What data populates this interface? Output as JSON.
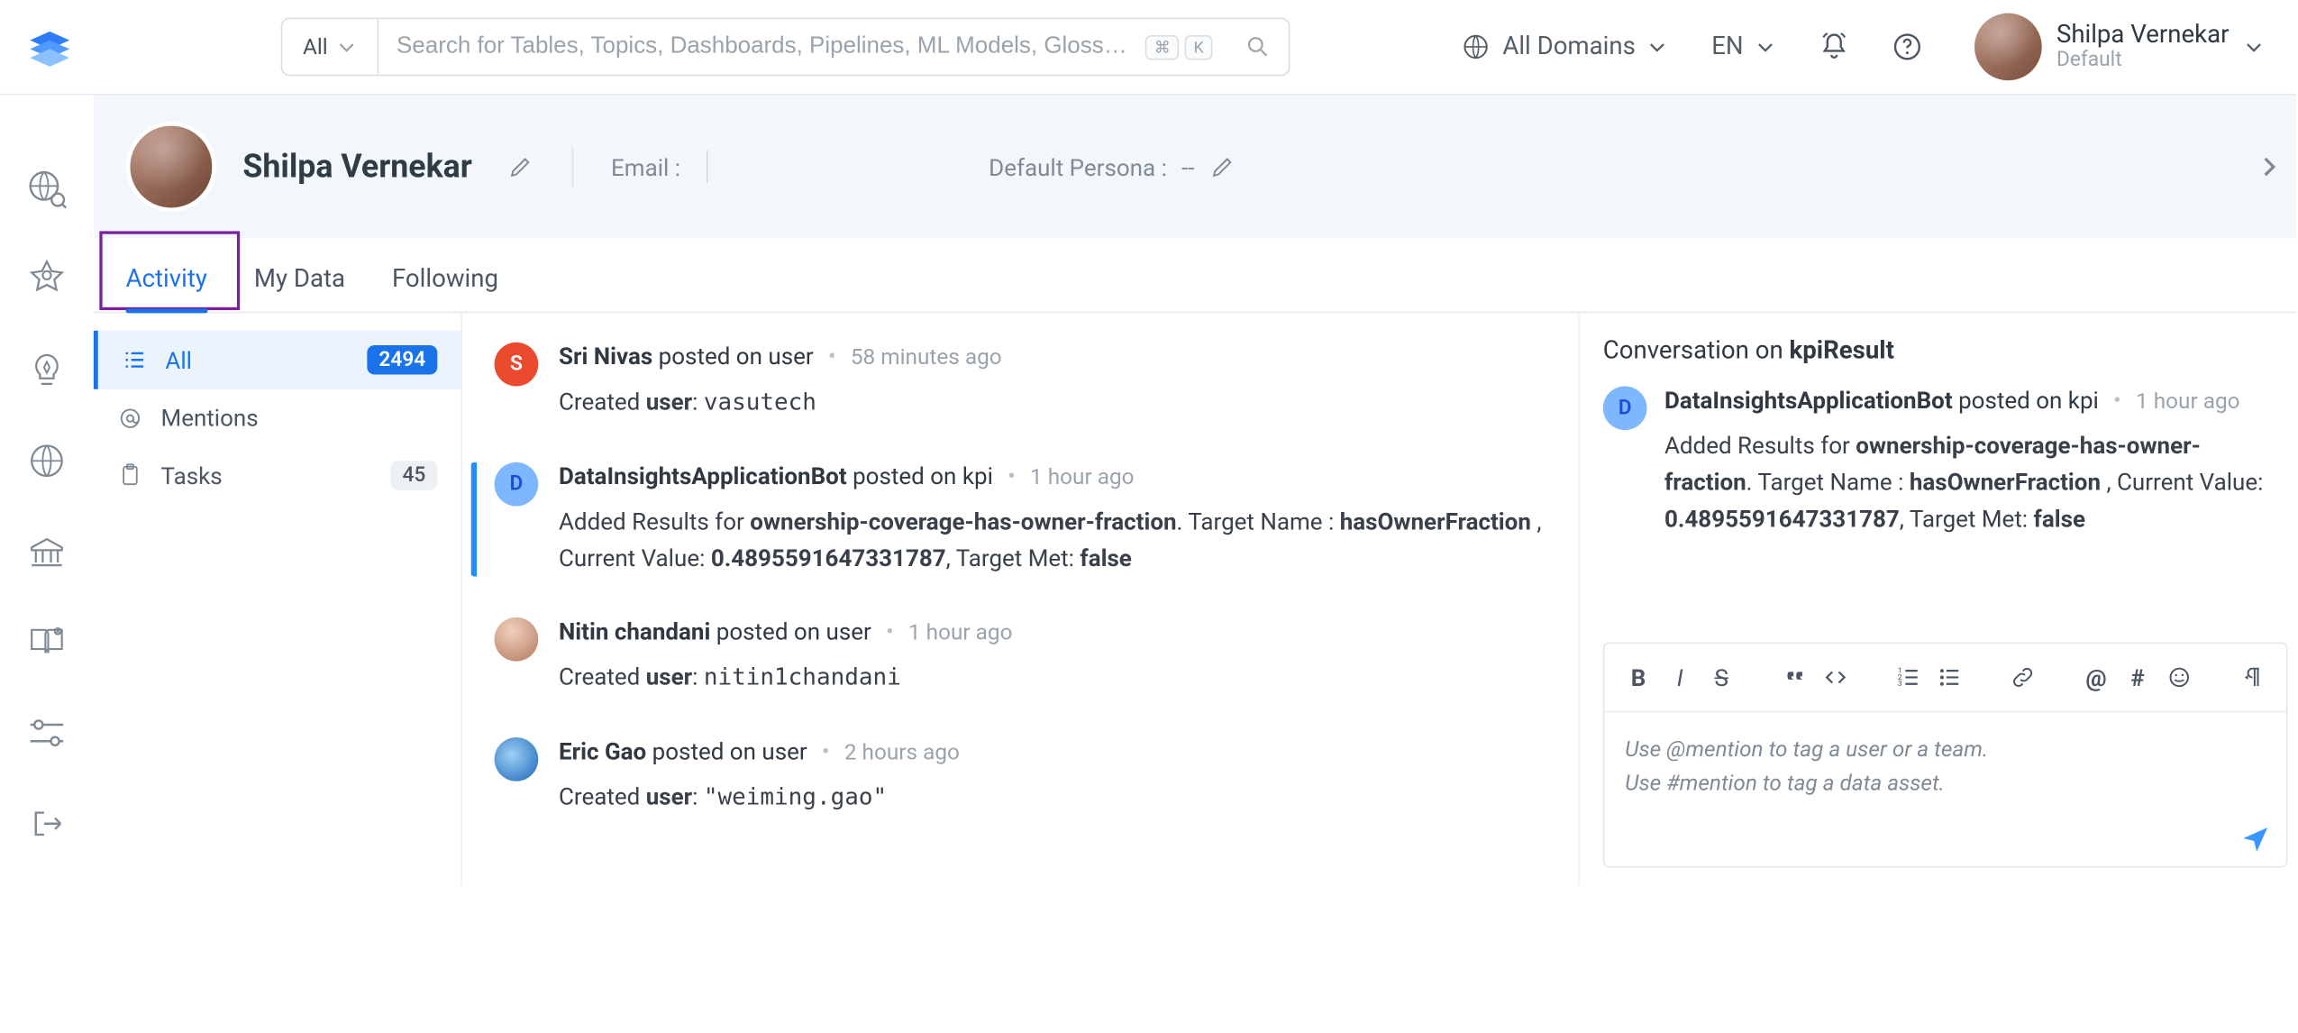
{
  "top": {
    "search_scope": "All",
    "search_placeholder": "Search for Tables, Topics, Dashboards, Pipelines, ML Models, Gloss…",
    "domains_label": "All Domains",
    "lang": "EN",
    "user_name": "Shilpa Vernekar",
    "user_persona": "Default",
    "shortcut_cmd": "⌘",
    "shortcut_k": "K"
  },
  "profile": {
    "name": "Shilpa Vernekar",
    "email_label": "Email :",
    "persona_label": "Default Persona :",
    "persona_value": "--"
  },
  "tabs": {
    "activity": "Activity",
    "mydata": "My Data",
    "following": "Following"
  },
  "filters": {
    "all_label": "All",
    "all_count": "2494",
    "mentions_label": "Mentions",
    "tasks_label": "Tasks",
    "tasks_count": "45"
  },
  "feed": [
    {
      "avatar_kind": "initial-S",
      "avatar_initial": "S",
      "who": "Sri Nivas",
      "action": "posted on user",
      "when": "58 minutes ago",
      "body_prefix": "Created ",
      "body_strong": "user",
      "body_sep": ": ",
      "body_code": "vasutech"
    },
    {
      "avatar_kind": "initial-D",
      "avatar_initial": "D",
      "who": "DataInsightsApplicationBot",
      "action": "posted on kpi",
      "when": "1 hour ago",
      "kpi": {
        "prefix": "Added Results for ",
        "name": "ownership-coverage-has-owner-fraction",
        "mid1": ". Target Name : ",
        "target": "hasOwnerFraction",
        "mid2": " , Current Value: ",
        "value": "0.4895591647331787",
        "mid3": ", Target Met: ",
        "met": "false"
      }
    },
    {
      "avatar_kind": "photo1",
      "avatar_initial": "",
      "who": "Nitin chandani",
      "action": "posted on user",
      "when": "1 hour ago",
      "body_prefix": "Created ",
      "body_strong": "user",
      "body_sep": ": ",
      "body_code": "nitin1chandani"
    },
    {
      "avatar_kind": "photo2",
      "avatar_initial": "",
      "who": "Eric Gao",
      "action": "posted on user",
      "when": "2 hours ago",
      "body_prefix": "Created ",
      "body_strong": "user",
      "body_sep": ": ",
      "body_code": "\"weiming.gao\""
    }
  ],
  "convo": {
    "title_prefix": "Conversation on ",
    "title_what": "kpiResult",
    "item": {
      "who": "DataInsightsApplicationBot",
      "action": "posted on kpi",
      "when": "1 hour ago",
      "kpi": {
        "prefix": "Added Results for ",
        "name": "ownership-coverage-has-owner-fraction",
        "mid1": ". Target Name : ",
        "target": "hasOwnerFraction",
        "mid2": " , Current Value: ",
        "value": "0.4895591647331787",
        "mid3": ", Target Met: ",
        "met": "false"
      }
    },
    "placeholder_line1": "Use @mention to tag a user or a team.",
    "placeholder_line2": "Use #mention to tag a data asset."
  }
}
